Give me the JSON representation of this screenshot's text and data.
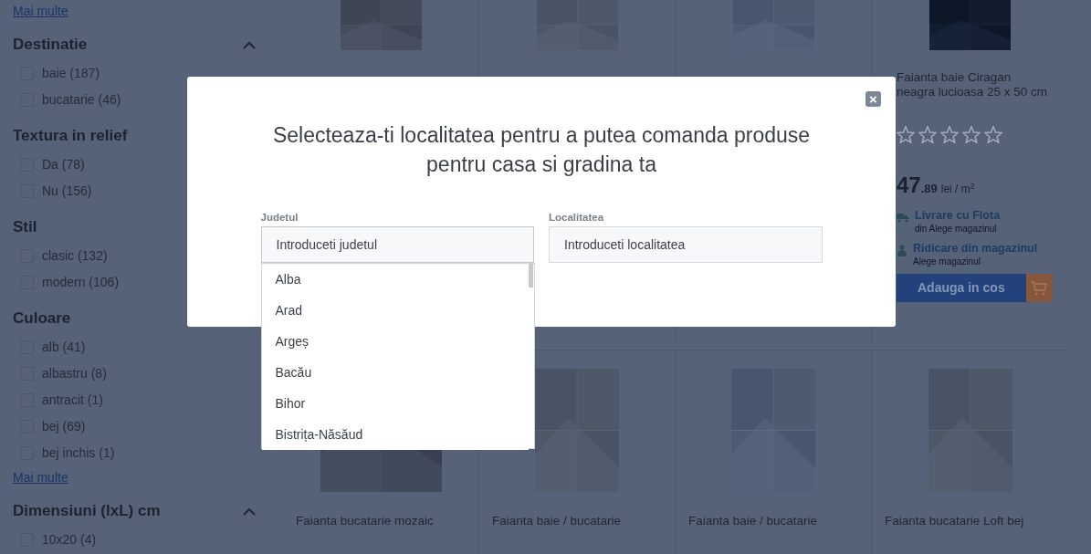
{
  "sidebar": {
    "top_link": "Mai multe",
    "groups": [
      {
        "title": "Destinatie",
        "expanded": true,
        "options": [
          {
            "label": "baie (187)",
            "checked": false
          },
          {
            "label": "bucatarie (46)",
            "checked": false
          }
        ]
      },
      {
        "title": "Textura in relief",
        "options": [
          {
            "label": "Da (78)",
            "checked": false
          },
          {
            "label": "Nu (156)",
            "checked": false
          }
        ]
      },
      {
        "title": "Stil",
        "options": [
          {
            "label": "clasic (132)",
            "checked": false
          },
          {
            "label": "modern (106)",
            "checked": false
          }
        ]
      },
      {
        "title": "Culoare",
        "options": [
          {
            "label": "alb (41)",
            "checked": false
          },
          {
            "label": "albastru (8)",
            "checked": false
          },
          {
            "label": "antracit (1)",
            "checked": false
          },
          {
            "label": "bej (69)",
            "checked": false
          },
          {
            "label": "bej inchis (1)",
            "checked": false
          }
        ],
        "more_link": "Mai multe"
      },
      {
        "title": "Dimensiuni (lxL) cm",
        "expanded": true,
        "options": [
          {
            "label": "10x20 (4)",
            "checked": false
          }
        ]
      }
    ]
  },
  "products_top": [
    {
      "kind": "picture"
    },
    {
      "kind": "picture"
    },
    {
      "kind": "picture"
    },
    {
      "kind": "picture",
      "title": "Faianta baie Ciragan neagra lucioasa 25 x 50 cm",
      "stars": 0,
      "price_int": "47",
      "price_dec": ".89",
      "price_unit": "lei / m$^{2}$",
      "delivery": [
        {
          "kind": "truck",
          "title": "Livrare cu Flota",
          "sub": "din Alege magazinul"
        },
        {
          "kind": "store",
          "title": "Ridicare din magazinul",
          "sub": "Alege magazinul"
        }
      ],
      "cart_button": "Adauga in cos"
    }
  ],
  "products_bottom": [
    {
      "kind": "picture",
      "title": "Faianta bucatarie mozaic"
    },
    {
      "kind": "picture",
      "title": "Faianta baie / bucatarie"
    },
    {
      "kind": "picture",
      "title": "Faianta baie / bucatarie"
    },
    {
      "kind": "picture",
      "title": "Faianta bucatarie Loft bej"
    }
  ],
  "modal": {
    "title": "Selecteaza-ti localitatea pentru a putea comanda produse pentru casa si gradina ta",
    "fields": [
      {
        "label": "Judetul",
        "placeholder": "Introduceti judetul",
        "focused": true,
        "options": [
          {
            "label": "Alba",
            "selected": false
          },
          {
            "label": "Arad",
            "selected": false
          },
          {
            "label": "Argeș",
            "selected": false
          },
          {
            "label": "Bacău",
            "selected": false
          },
          {
            "label": "Bihor",
            "selected": false
          },
          {
            "label": "Bistrița-Năsăud",
            "selected": false
          }
        ]
      },
      {
        "label": "Localitatea",
        "placeholder": "Introduceti localitatea",
        "focused": false
      }
    ],
    "close": "×"
  }
}
